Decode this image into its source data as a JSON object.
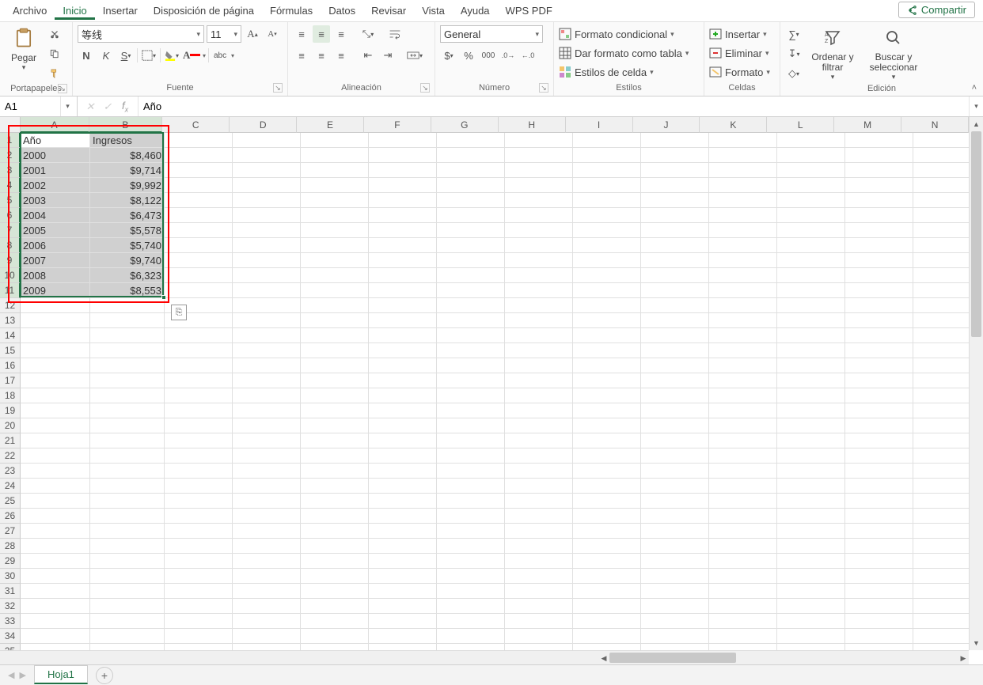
{
  "menu": {
    "items": [
      "Archivo",
      "Inicio",
      "Insertar",
      "Disposición de página",
      "Fórmulas",
      "Datos",
      "Revisar",
      "Vista",
      "Ayuda",
      "WPS PDF"
    ],
    "active_index": 1,
    "share_label": "Compartir"
  },
  "ribbon": {
    "clipboard": {
      "paste_label": "Pegar",
      "group_label": "Portapapeles"
    },
    "font": {
      "name": "等线",
      "size": "11",
      "group_label": "Fuente"
    },
    "alignment": {
      "group_label": "Alineación"
    },
    "number": {
      "format": "General",
      "group_label": "Número"
    },
    "styles": {
      "cond": "Formato condicional",
      "table": "Dar formato como tabla",
      "cell": "Estilos de celda",
      "group_label": "Estilos"
    },
    "cells": {
      "insert": "Insertar",
      "delete": "Eliminar",
      "format": "Formato",
      "group_label": "Celdas"
    },
    "editing": {
      "sort": "Ordenar y filtrar",
      "find": "Buscar y seleccionar",
      "group_label": "Edición"
    }
  },
  "formula_bar": {
    "name_box": "A1",
    "formula": "Año"
  },
  "columns": [
    "A",
    "B",
    "C",
    "D",
    "E",
    "F",
    "G",
    "H",
    "I",
    "J",
    "K",
    "L",
    "M",
    "N"
  ],
  "col_widths": {
    "A": 88,
    "B": 94,
    "other": 86
  },
  "row_headers_count": 35,
  "selected_rows_to": 11,
  "selected_cols": [
    "A",
    "B"
  ],
  "active_cell": "A1",
  "data": {
    "headers": [
      "Año",
      "Ingresos"
    ],
    "rows": [
      {
        "year": "2000",
        "income": "$8,460"
      },
      {
        "year": "2001",
        "income": "$9,714"
      },
      {
        "year": "2002",
        "income": "$9,992"
      },
      {
        "year": "2003",
        "income": "$8,122"
      },
      {
        "year": "2004",
        "income": "$6,473"
      },
      {
        "year": "2005",
        "income": "$5,578"
      },
      {
        "year": "2006",
        "income": "$5,740"
      },
      {
        "year": "2007",
        "income": "$9,740"
      },
      {
        "year": "2008",
        "income": "$6,323"
      },
      {
        "year": "2009",
        "income": "$8,553"
      }
    ]
  },
  "sheet": {
    "name": "Hoja1"
  }
}
